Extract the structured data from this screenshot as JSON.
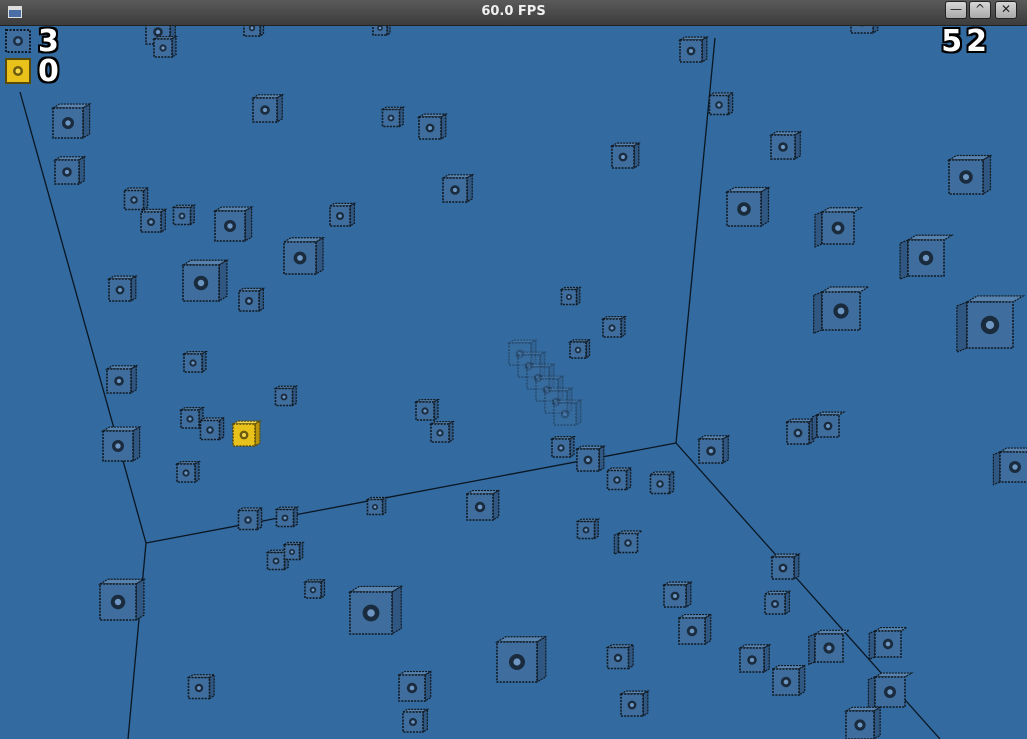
{
  "window": {
    "title": "60.0 FPS",
    "buttons": {
      "minimize": "—",
      "maximize": "^",
      "close": "✕"
    }
  },
  "hud": {
    "blue_cube_count": "3",
    "gold_cube_count": "0",
    "score": "52"
  },
  "colors": {
    "background": "#336a9f",
    "cube_face": "#3e6d9e",
    "cube_gold": "#e8c21a",
    "edge": "#101820"
  },
  "icons": {
    "blue_cube": "spiky-blue-cube-icon",
    "gold_cube": "gold-cube-icon"
  }
}
